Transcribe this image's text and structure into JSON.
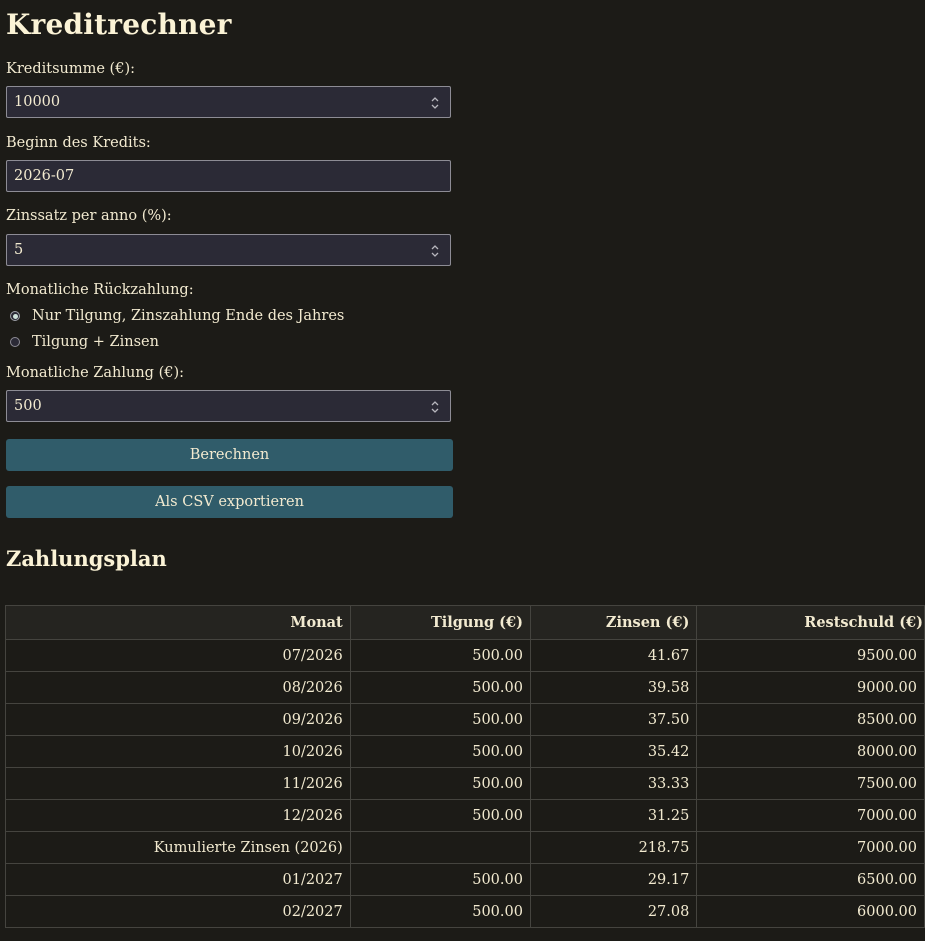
{
  "title": "Kreditrechner",
  "form": {
    "amount_label": "Kreditsumme (€):",
    "amount_value": "10000",
    "start_label": "Beginn des Kredits:",
    "start_value": "2026-07",
    "rate_label": "Zinssatz per anno (%):",
    "rate_value": "5",
    "repayment_label": "Monatliche Rückzahlung:",
    "option_1": "Nur Tilgung, Zinszahlung Ende des Jahres",
    "option_2": "Tilgung + Zinsen",
    "payment_label": "Monatliche Zahlung (€):",
    "payment_value": "500",
    "calc_button": "Berechnen",
    "export_button": "Als CSV exportieren"
  },
  "schedule": {
    "title": "Zahlungsplan",
    "headers": [
      "Monat",
      "Tilgung (€)",
      "Zinsen (€)",
      "Restschuld (€)"
    ],
    "rows": [
      [
        "07/2026",
        "500.00",
        "41.67",
        "9500.00"
      ],
      [
        "08/2026",
        "500.00",
        "39.58",
        "9000.00"
      ],
      [
        "09/2026",
        "500.00",
        "37.50",
        "8500.00"
      ],
      [
        "10/2026",
        "500.00",
        "35.42",
        "8000.00"
      ],
      [
        "11/2026",
        "500.00",
        "33.33",
        "7500.00"
      ],
      [
        "12/2026",
        "500.00",
        "31.25",
        "7000.00"
      ],
      [
        "Kumulierte Zinsen (2026)",
        "",
        "218.75",
        "7000.00"
      ],
      [
        "01/2027",
        "500.00",
        "29.17",
        "6500.00"
      ],
      [
        "02/2027",
        "500.00",
        "27.08",
        "6000.00"
      ]
    ]
  }
}
